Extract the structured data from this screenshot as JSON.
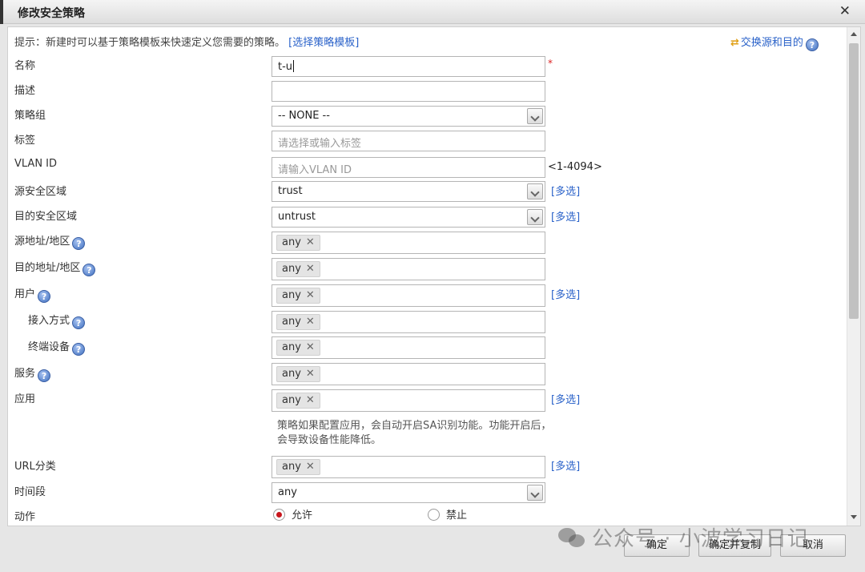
{
  "dialog": {
    "title": "修改安全策略"
  },
  "hint": {
    "text": "提示：新建时可以基于策略模板来快速定义您需要的策略。",
    "link": "[选择策略模板]"
  },
  "swap": {
    "label": "交换源和目的"
  },
  "fields": {
    "name": {
      "label": "名称",
      "value": "t-u",
      "required_mark": "*"
    },
    "desc": {
      "label": "描述",
      "value": ""
    },
    "group": {
      "label": "策略组",
      "value": "-- NONE --"
    },
    "tag": {
      "label": "标签",
      "placeholder": "请选择或输入标签"
    },
    "vlan": {
      "label": "VLAN ID",
      "placeholder": "请输入VLAN ID",
      "range": "<1-4094>"
    },
    "src_zone": {
      "label": "源安全区域",
      "value": "trust",
      "multi": "[多选]"
    },
    "dst_zone": {
      "label": "目的安全区域",
      "value": "untrust",
      "multi": "[多选]"
    },
    "src_addr": {
      "label": "源地址/地区",
      "tag": "any"
    },
    "dst_addr": {
      "label": "目的地址/地区",
      "tag": "any"
    },
    "user": {
      "label": "用户",
      "tag": "any",
      "multi": "[多选]"
    },
    "access": {
      "label": "接入方式",
      "tag": "any"
    },
    "terminal": {
      "label": "终端设备",
      "tag": "any"
    },
    "service": {
      "label": "服务",
      "tag": "any"
    },
    "app": {
      "label": "应用",
      "tag": "any",
      "multi": "[多选]",
      "note": "策略如果配置应用，会自动开启SA识别功能。功能开启后，会导致设备性能降低。"
    },
    "url": {
      "label": "URL分类",
      "tag": "any",
      "multi": "[多选]"
    },
    "time": {
      "label": "时间段",
      "value": "any"
    },
    "action": {
      "label": "动作",
      "options": [
        "允许",
        "禁止"
      ],
      "selected": "允许"
    }
  },
  "buttons": {
    "ok": "确定",
    "ok_copy": "确定并复制",
    "cancel": "取消"
  },
  "watermark": "公众号 · 小波学习日记"
}
